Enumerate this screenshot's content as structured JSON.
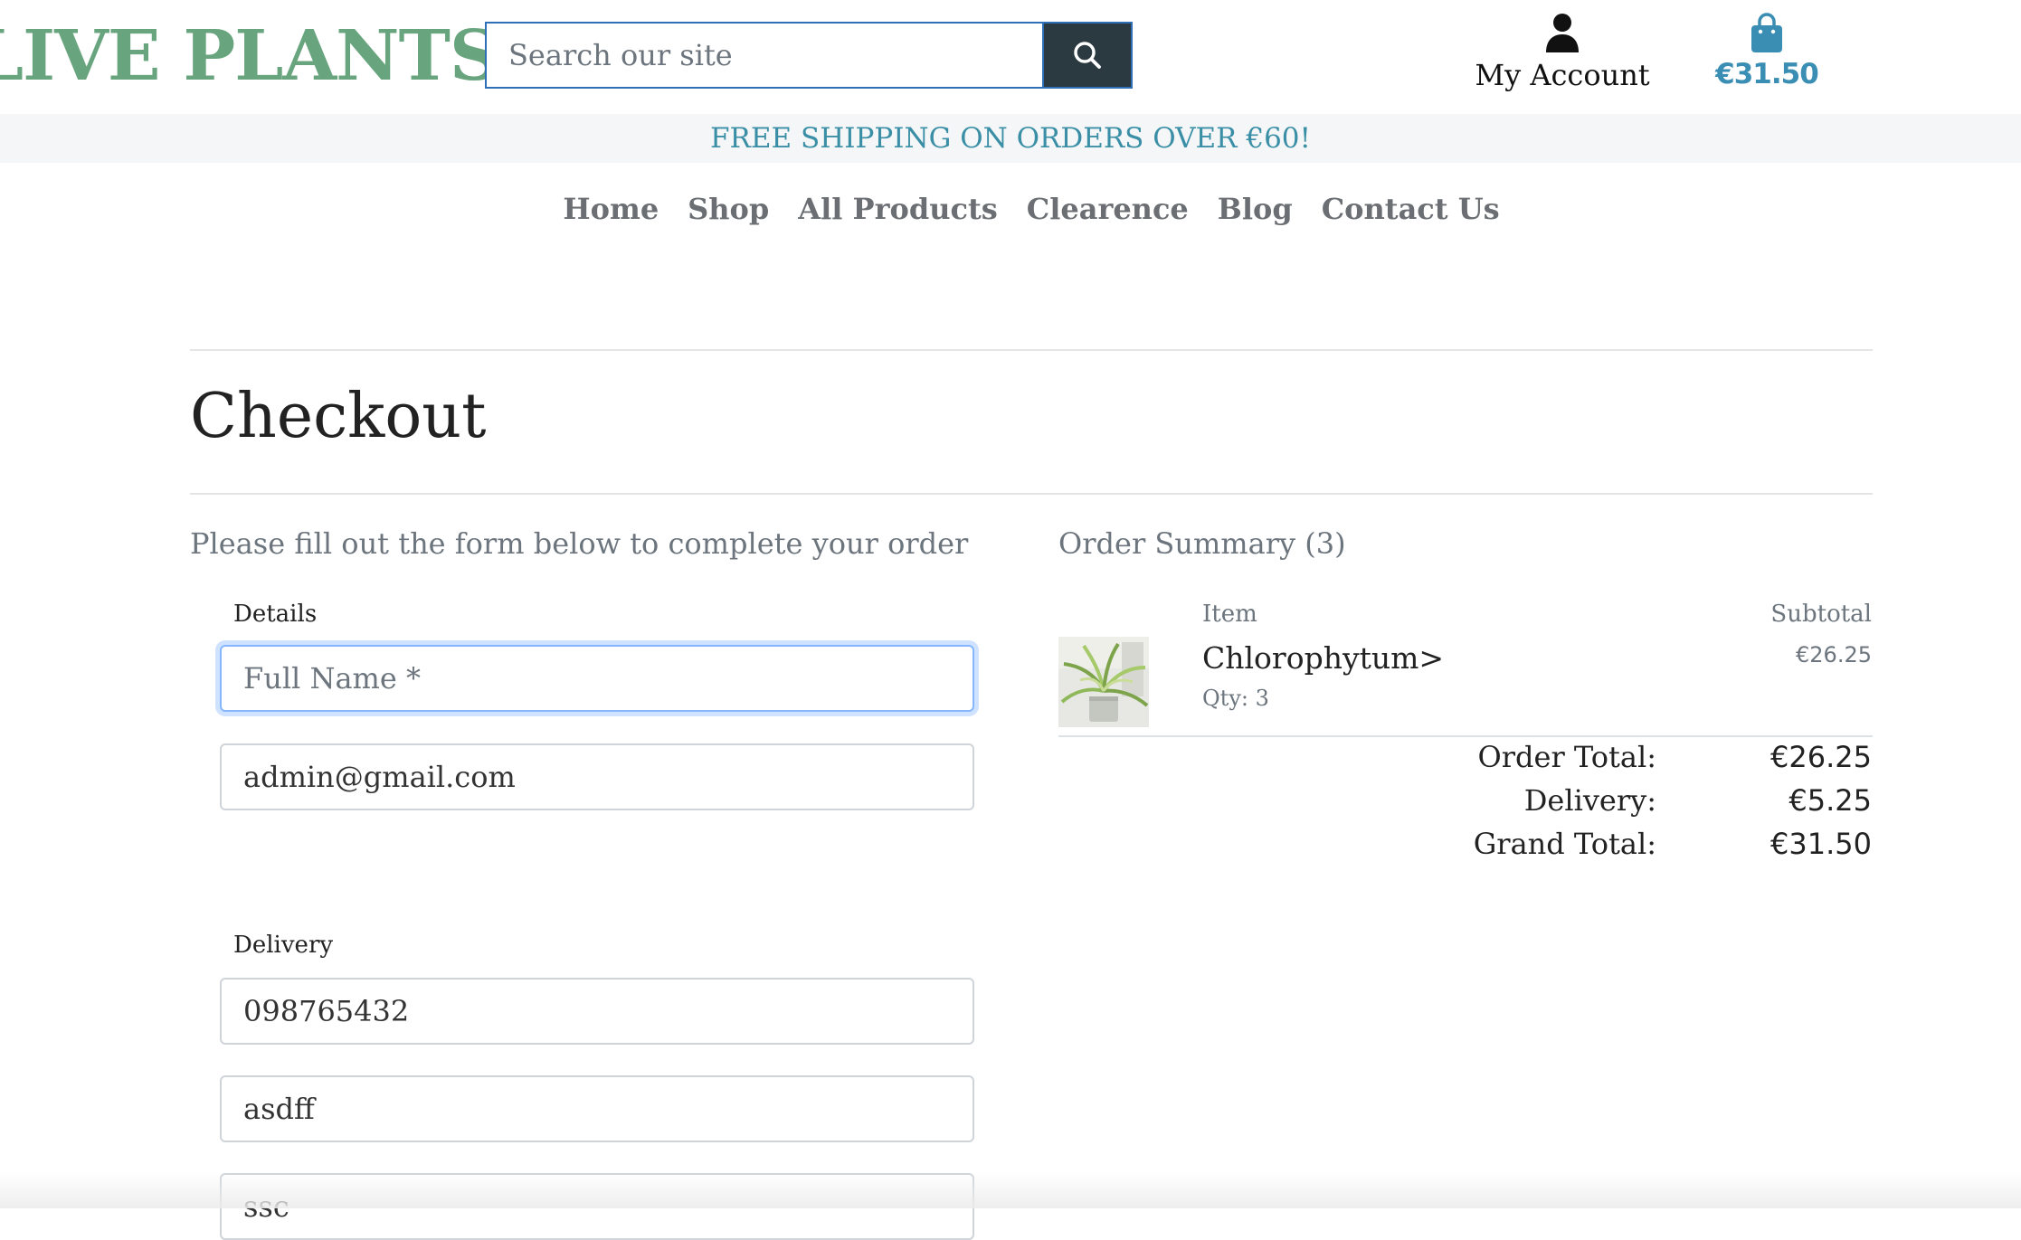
{
  "header": {
    "logo": "LIVE PLANTS",
    "search_placeholder": "Search our site",
    "account_label": "My Account",
    "bag_total": "€31.50",
    "accent_color": "#68a57e"
  },
  "banner": {
    "text": "FREE SHIPPING ON ORDERS OVER €60!"
  },
  "nav": {
    "items": [
      "Home",
      "Shop",
      "All Products",
      "Clearence",
      "Blog",
      "Contact Us"
    ]
  },
  "page": {
    "title": "Checkout",
    "form_intro": "Please fill out the form below to complete your order"
  },
  "form": {
    "details_legend": "Details",
    "full_name_placeholder": "Full Name *",
    "email_value": "admin@gmail.com",
    "delivery_legend": "Delivery",
    "phone_value": "098765432",
    "address1_value": "asdff",
    "address2_value": "ssc"
  },
  "summary": {
    "title": "Order Summary (3)",
    "col_item": "Item",
    "col_subtotal": "Subtotal",
    "item": {
      "name": "Chlorophytum>",
      "qty": "Qty: 3",
      "subtotal": "€26.25"
    },
    "order_total_label": "Order Total:",
    "order_total_value": "€26.25",
    "delivery_label": "Delivery:",
    "delivery_value": "€5.25",
    "grand_total_label": "Grand Total:",
    "grand_total_value": "€31.50"
  }
}
